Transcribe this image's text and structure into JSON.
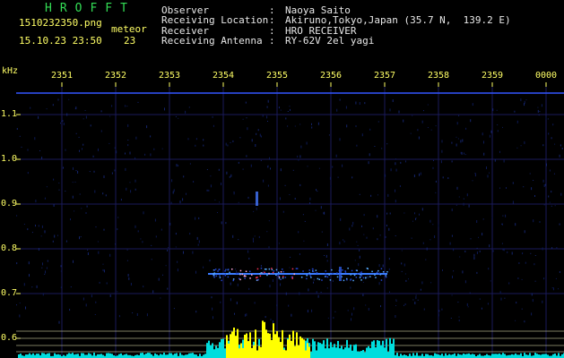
{
  "header": {
    "app_title": "HROFFT",
    "filename": "1510232350.png",
    "timestamp": "15.10.23 23:50",
    "meteor_label": "meteor",
    "meteor_count": "23",
    "fields": [
      {
        "label": "Observer",
        "sep": ":",
        "value": "Naoya Saito"
      },
      {
        "label": "Receiving Location",
        "sep": ":",
        "value": "Akiruno,Tokyo,Japan (35.7 N,  139.2 E)"
      },
      {
        "label": "Receiver",
        "sep": ":",
        "value": "HRO RECEIVER"
      },
      {
        "label": "Receiving Antenna",
        "sep": ":",
        "value": "RY-62V 2el yagi"
      }
    ]
  },
  "spectrogram": {
    "unit_label": "kHz",
    "time_ticks": [
      "2351",
      "2352",
      "2353",
      "2354",
      "2355",
      "2356",
      "2357",
      "2358",
      "2359",
      "0000"
    ],
    "freq_ticks": [
      "1.1",
      "1.0",
      "0.9",
      "0.8",
      "0.7",
      "0.6"
    ],
    "colors": {
      "background": "#000000",
      "grid": "#1a1a5a",
      "tick_text": "#ffff66",
      "carrier": "#3355ff",
      "power_high": "#ffff00",
      "power_low": "#00dddd",
      "baseline": "#cfcfa0"
    }
  }
}
